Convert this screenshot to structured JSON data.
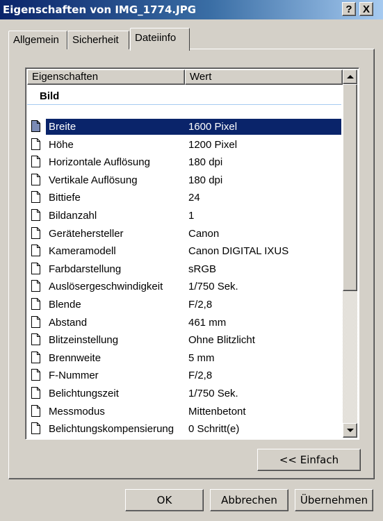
{
  "window": {
    "title": "Eigenschaften von IMG_1774.JPG",
    "help_label": "?",
    "close_label": "X"
  },
  "tabs": [
    {
      "label": "Allgemein",
      "active": false
    },
    {
      "label": "Sicherheit",
      "active": false
    },
    {
      "label": "Dateiinfo",
      "active": true
    }
  ],
  "list": {
    "columns": [
      "Eigenschaften",
      "Wert"
    ],
    "group": "Bild",
    "rows": [
      {
        "name": "Breite",
        "value": "1600 Pixel",
        "selected": true
      },
      {
        "name": "Höhe",
        "value": "1200 Pixel"
      },
      {
        "name": "Horizontale Auflösung",
        "value": "180 dpi"
      },
      {
        "name": "Vertikale Auflösung",
        "value": "180 dpi"
      },
      {
        "name": "Bittiefe",
        "value": "24"
      },
      {
        "name": "Bildanzahl",
        "value": "1"
      },
      {
        "name": "Gerätehersteller",
        "value": "Canon"
      },
      {
        "name": "Kameramodell",
        "value": "Canon DIGITAL IXUS"
      },
      {
        "name": "Farbdarstellung",
        "value": "sRGB"
      },
      {
        "name": "Auslösergeschwindigkeit",
        "value": "1/750 Sek."
      },
      {
        "name": "Blende",
        "value": "F/2,8"
      },
      {
        "name": "Abstand",
        "value": "461 mm"
      },
      {
        "name": "Blitzeinstellung",
        "value": "Ohne Blitzlicht"
      },
      {
        "name": "Brennweite",
        "value": "5 mm"
      },
      {
        "name": "F-Nummer",
        "value": "F/2,8"
      },
      {
        "name": "Belichtungszeit",
        "value": "1/750 Sek."
      },
      {
        "name": "Messmodus",
        "value": "Mittenbetont"
      },
      {
        "name": "Belichtungskompensierung",
        "value": "0 Schritt(e)"
      }
    ]
  },
  "buttons": {
    "simple": "<< Einfach",
    "ok": "OK",
    "cancel": "Abbrechen",
    "apply": "Übernehmen"
  },
  "colors": {
    "titlebar_start": "#0a246a",
    "titlebar_end": "#a6caf0",
    "selection": "#0a246a",
    "face": "#d4d0c8"
  }
}
